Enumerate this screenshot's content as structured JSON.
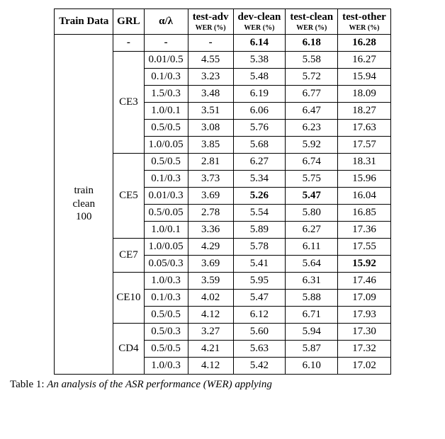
{
  "headers": {
    "train_data": "Train Data",
    "grl": "GRL",
    "alpha_lambda": "α/λ",
    "test_adv": "test-adv",
    "dev_clean": "dev-clean",
    "test_clean": "test-clean",
    "test_other": "test-other",
    "wer_label": "WER (%)"
  },
  "train_data_label": [
    "train",
    "clean",
    "100"
  ],
  "baseline": {
    "grl": "-",
    "alpha": "-",
    "test_adv": "-",
    "dev_clean": "6.14",
    "test_clean": "6.18",
    "test_other": "16.28"
  },
  "groups": [
    {
      "grl": "CE3",
      "rows": [
        {
          "alpha": "0.01/0.5",
          "test_adv": "4.55",
          "dev_clean": "5.38",
          "test_clean": "5.58",
          "test_other": "16.27"
        },
        {
          "alpha": "0.1/0.3",
          "test_adv": "3.23",
          "dev_clean": "5.48",
          "test_clean": "5.72",
          "test_other": "15.94"
        },
        {
          "alpha": "1.5/0.3",
          "test_adv": "3.48",
          "dev_clean": "6.19",
          "test_clean": "6.77",
          "test_other": "18.09"
        },
        {
          "alpha": "1.0/0.1",
          "test_adv": "3.51",
          "dev_clean": "6.06",
          "test_clean": "6.47",
          "test_other": "18.27"
        },
        {
          "alpha": "0.5/0.5",
          "test_adv": "3.08",
          "dev_clean": "5.76",
          "test_clean": "6.23",
          "test_other": "17.63"
        },
        {
          "alpha": "1.0/0.05",
          "test_adv": "3.85",
          "dev_clean": "5.68",
          "test_clean": "5.92",
          "test_other": "17.57"
        }
      ]
    },
    {
      "grl": "CE5",
      "rows": [
        {
          "alpha": "0.5/0.5",
          "test_adv": "2.81",
          "dev_clean": "6.27",
          "test_clean": "6.74",
          "test_other": "18.31"
        },
        {
          "alpha": "0.1/0.3",
          "test_adv": "3.73",
          "dev_clean": "5.34",
          "test_clean": "5.75",
          "test_other": "15.96"
        },
        {
          "alpha": "0.01/0.3",
          "test_adv": "3.69",
          "dev_clean": "5.26",
          "dev_clean_bold": true,
          "test_clean": "5.47",
          "test_clean_bold": true,
          "test_other": "16.04"
        },
        {
          "alpha": "0.5/0.05",
          "test_adv": "2.78",
          "dev_clean": "5.54",
          "test_clean": "5.80",
          "test_other": "16.85"
        },
        {
          "alpha": "1.0/0.1",
          "test_adv": "3.36",
          "dev_clean": "5.89",
          "test_clean": "6.27",
          "test_other": "17.36"
        }
      ]
    },
    {
      "grl": "CE7",
      "rows": [
        {
          "alpha": "1.0/0.05",
          "test_adv": "4.29",
          "dev_clean": "5.78",
          "test_clean": "6.11",
          "test_other": "17.55"
        },
        {
          "alpha": "0.05/0.3",
          "test_adv": "3.69",
          "dev_clean": "5.41",
          "test_clean": "5.64",
          "test_other": "15.92",
          "test_other_bold": true
        }
      ]
    },
    {
      "grl": "CE10",
      "rows": [
        {
          "alpha": "1.0/0.3",
          "test_adv": "3.59",
          "dev_clean": "5.95",
          "test_clean": "6.31",
          "test_other": "17.46"
        },
        {
          "alpha": "0.1/0.3",
          "test_adv": "4.02",
          "dev_clean": "5.47",
          "test_clean": "5.88",
          "test_other": "17.09"
        },
        {
          "alpha": "0.5/0.5",
          "test_adv": "4.12",
          "dev_clean": "6.12",
          "test_clean": "6.71",
          "test_other": "17.93"
        }
      ]
    },
    {
      "grl": "CD4",
      "rows": [
        {
          "alpha": "0.5/0.3",
          "test_adv": "3.27",
          "dev_clean": "5.60",
          "test_clean": "5.94",
          "test_other": "17.30"
        },
        {
          "alpha": "0.5/0.5",
          "test_adv": "4.21",
          "dev_clean": "5.63",
          "test_clean": "5.87",
          "test_other": "17.32"
        },
        {
          "alpha": "1.0/0.3",
          "test_adv": "4.12",
          "dev_clean": "5.42",
          "test_clean": "6.10",
          "test_other": "17.02"
        }
      ]
    }
  ],
  "caption": {
    "label": "Table 1:",
    "text": "An analysis of the ASR performance (WER) applying"
  },
  "chart_data": {
    "type": "table",
    "title": "ASR performance (WER) analysis",
    "columns": [
      "Train Data",
      "GRL",
      "α/λ",
      "test-adv WER (%)",
      "dev-clean WER (%)",
      "test-clean WER (%)",
      "test-other WER (%)"
    ],
    "rows": [
      [
        "train clean 100",
        "-",
        "-",
        "-",
        "6.14",
        "6.18",
        "16.28"
      ],
      [
        "train clean 100",
        "CE3",
        "0.01/0.5",
        "4.55",
        "5.38",
        "5.58",
        "16.27"
      ],
      [
        "train clean 100",
        "CE3",
        "0.1/0.3",
        "3.23",
        "5.48",
        "5.72",
        "15.94"
      ],
      [
        "train clean 100",
        "CE3",
        "1.5/0.3",
        "3.48",
        "6.19",
        "6.77",
        "18.09"
      ],
      [
        "train clean 100",
        "CE3",
        "1.0/0.1",
        "3.51",
        "6.06",
        "6.47",
        "18.27"
      ],
      [
        "train clean 100",
        "CE3",
        "0.5/0.5",
        "3.08",
        "5.76",
        "6.23",
        "17.63"
      ],
      [
        "train clean 100",
        "CE3",
        "1.0/0.05",
        "3.85",
        "5.68",
        "5.92",
        "17.57"
      ],
      [
        "train clean 100",
        "CE5",
        "0.5/0.5",
        "2.81",
        "6.27",
        "6.74",
        "18.31"
      ],
      [
        "train clean 100",
        "CE5",
        "0.1/0.3",
        "3.73",
        "5.34",
        "5.75",
        "15.96"
      ],
      [
        "train clean 100",
        "CE5",
        "0.01/0.3",
        "3.69",
        "5.26",
        "5.47",
        "16.04"
      ],
      [
        "train clean 100",
        "CE5",
        "0.5/0.05",
        "2.78",
        "5.54",
        "5.80",
        "16.85"
      ],
      [
        "train clean 100",
        "CE5",
        "1.0/0.1",
        "3.36",
        "5.89",
        "6.27",
        "17.36"
      ],
      [
        "train clean 100",
        "CE7",
        "1.0/0.05",
        "4.29",
        "5.78",
        "6.11",
        "17.55"
      ],
      [
        "train clean 100",
        "CE7",
        "0.05/0.3",
        "3.69",
        "5.41",
        "5.64",
        "15.92"
      ],
      [
        "train clean 100",
        "CE10",
        "1.0/0.3",
        "3.59",
        "5.95",
        "6.31",
        "17.46"
      ],
      [
        "train clean 100",
        "CE10",
        "0.1/0.3",
        "4.02",
        "5.47",
        "5.88",
        "17.09"
      ],
      [
        "train clean 100",
        "CE10",
        "0.5/0.5",
        "4.12",
        "6.12",
        "6.71",
        "17.93"
      ],
      [
        "train clean 100",
        "CD4",
        "0.5/0.3",
        "3.27",
        "5.60",
        "5.94",
        "17.30"
      ],
      [
        "train clean 100",
        "CD4",
        "0.5/0.5",
        "4.21",
        "5.63",
        "5.87",
        "17.32"
      ],
      [
        "train clean 100",
        "CD4",
        "1.0/0.3",
        "4.12",
        "5.42",
        "6.10",
        "17.02"
      ]
    ]
  }
}
